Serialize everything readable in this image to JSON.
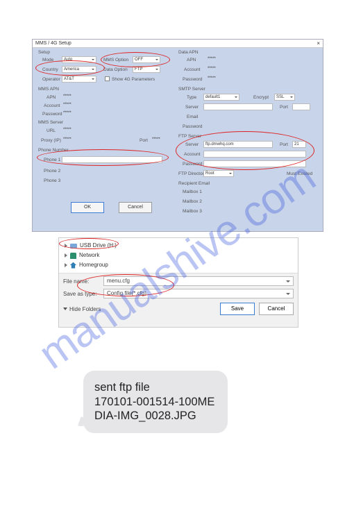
{
  "watermark": "manualshive.com",
  "cfg": {
    "title": "MMS / 4G Setup",
    "setup": {
      "label": "Setup",
      "mode_label": "Mode",
      "mode_value": "Auto",
      "mms_option_label": "MMS Option",
      "mms_option_value": "OFF",
      "country_label": "Country",
      "country_value": "America",
      "data_option_label": "Data Option",
      "data_option_value": "FTP",
      "operator_label": "Operator",
      "operator_value": "AT&T",
      "show4g_label": "Show 4G Parameters"
    },
    "mms_apn": {
      "label": "MMS APN",
      "apn_label": "APN",
      "apn_value": "*****",
      "account_label": "Account",
      "account_value": "*****",
      "password_label": "Password",
      "password_value": "*****"
    },
    "mms_server": {
      "label": "MMS Server",
      "url_label": "URL",
      "url_value": "*****",
      "proxy_label": "Proxy (IP)",
      "proxy_value": "*****",
      "port_label": "Port",
      "port_value": "*****"
    },
    "phone": {
      "label": "Phone Number",
      "p1_label": "Phone 1",
      "p1_value": "",
      "p2_label": "Phone 2",
      "p2_value": "",
      "p3_label": "Phone 3",
      "p3_value": ""
    },
    "data_apn": {
      "label": "Data APN",
      "apn_label": "APN",
      "apn_value": "*****",
      "account_label": "Account",
      "account_value": "*****",
      "password_label": "Password",
      "password_value": "*****"
    },
    "smtp": {
      "label": "SMTP Server",
      "type_label": "Type",
      "type_value": "default1",
      "encrypt_label": "Encrypt",
      "encrypt_value": "SSL",
      "server_label": "Server",
      "server_value": "",
      "port_label": "Port",
      "port_value": "",
      "email_label": "Email",
      "email_value": "",
      "password_label": "Password",
      "password_value": ""
    },
    "ftp": {
      "label": "FTP Server",
      "server_label": "Server",
      "server_value": "ftp.dmwhq.com",
      "port_label": "Port",
      "port_value": "21",
      "account_label": "Account",
      "account_value": "",
      "password_label": "Password",
      "password_value": "",
      "dir_label": "FTP Directory",
      "dir_value": "Root",
      "must_label": "Must Existed"
    },
    "emails": {
      "label": "Recipient Email",
      "m1": "Mailbox 1",
      "m2": "Mailbox 2",
      "m3": "Mailbox 3"
    },
    "ok": "OK",
    "cancel": "Cancel"
  },
  "save": {
    "locations": {
      "usb": "USB Drive (H:)",
      "network": "Network",
      "homegroup": "Homegroup"
    },
    "filename_label": "File name:",
    "filename_value": "menu.cfg",
    "type_label": "Save as type:",
    "type_value": "Config file(*.cfg)",
    "hide": "Hide Folders",
    "save_btn": "Save",
    "cancel_btn": "Cancel"
  },
  "sms": {
    "line1": "sent ftp file",
    "line2": "170101-001514-100ME",
    "line3": "DIA-IMG_0028.JPG"
  }
}
